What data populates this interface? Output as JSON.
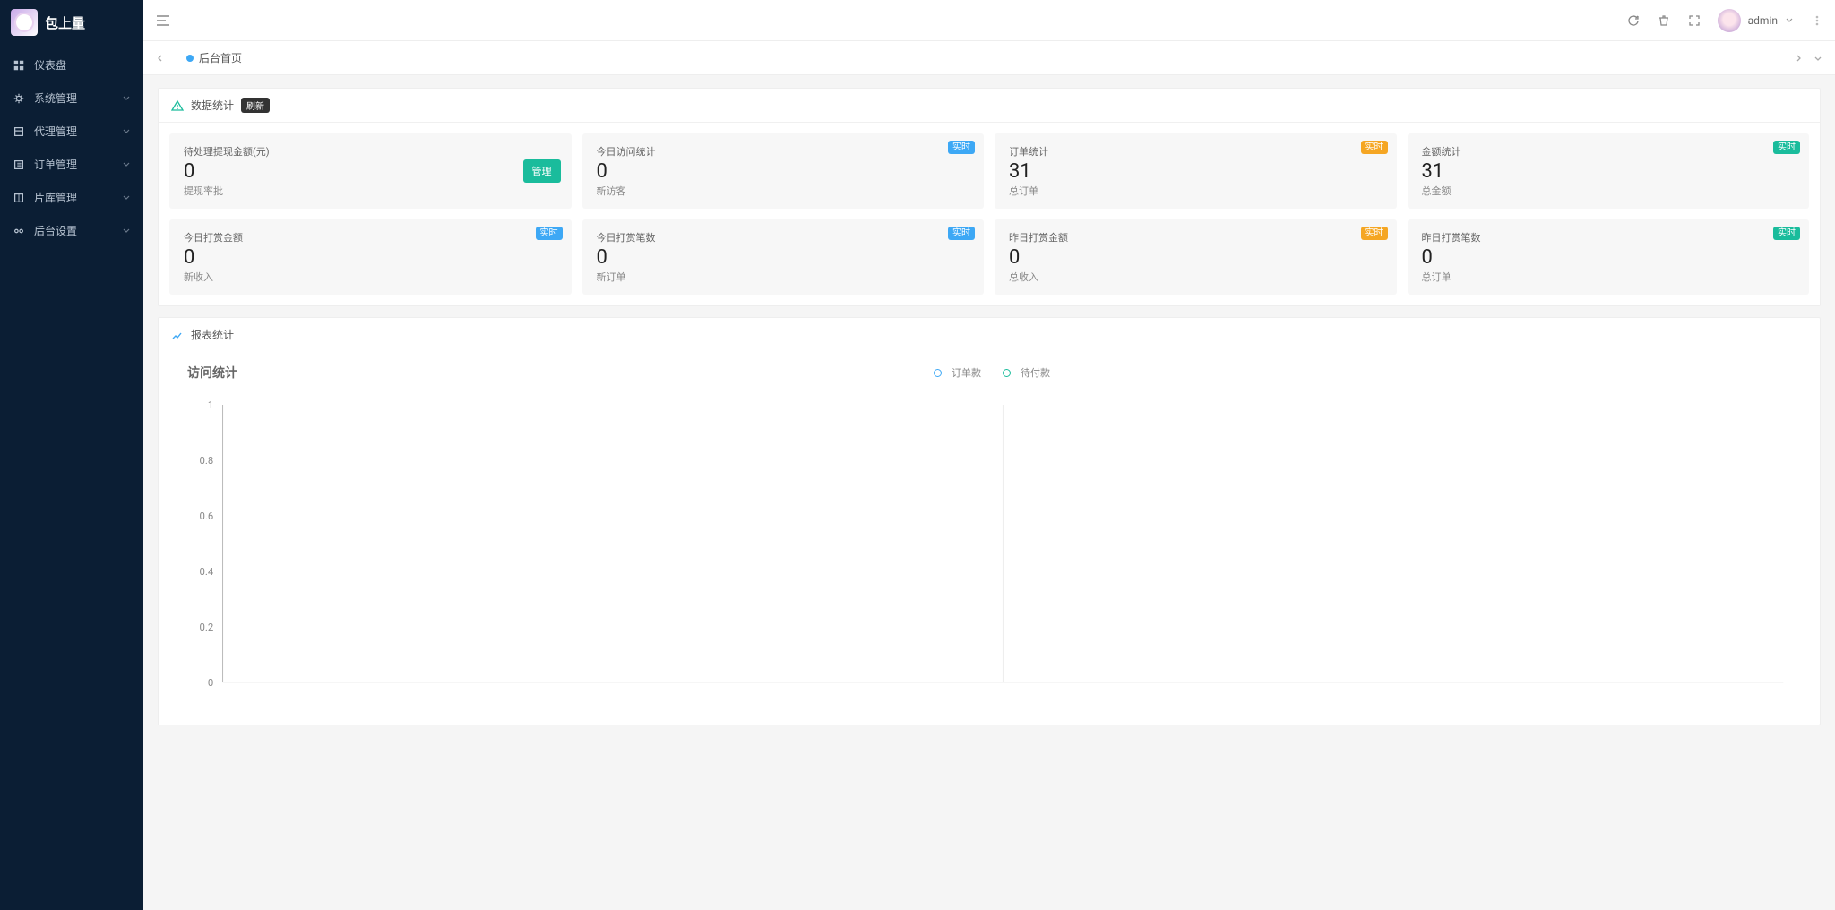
{
  "app_name": "包上量",
  "user": {
    "name": "admin"
  },
  "sidebar": {
    "items": [
      {
        "label": "仪表盘",
        "icon": "dashboard",
        "expandable": false
      },
      {
        "label": "系统管理",
        "icon": "gear",
        "expandable": true
      },
      {
        "label": "代理管理",
        "icon": "box",
        "expandable": true
      },
      {
        "label": "订单管理",
        "icon": "list",
        "expandable": true
      },
      {
        "label": "片库管理",
        "icon": "film",
        "expandable": true
      },
      {
        "label": "后台设置",
        "icon": "cog",
        "expandable": true
      }
    ]
  },
  "tab": {
    "label": "后台首页"
  },
  "panels": {
    "stats": {
      "title": "数据统计",
      "refresh": "刷新"
    },
    "report": {
      "title": "报表统计"
    }
  },
  "stats": [
    {
      "title": "待处理提现金额(元)",
      "value": "0",
      "sub": "提现率批",
      "badge": null,
      "manage": "管理"
    },
    {
      "title": "今日访问统计",
      "value": "0",
      "sub": "新访客",
      "badge": "实时",
      "badgeColor": "blue"
    },
    {
      "title": "订单统计",
      "value": "31",
      "sub": "总订单",
      "badge": "实时",
      "badgeColor": "orange"
    },
    {
      "title": "金额统计",
      "value": "31",
      "sub": "总金额",
      "badge": "实时",
      "badgeColor": "green"
    },
    {
      "title": "今日打赏金额",
      "value": "0",
      "sub": "新收入",
      "badge": "实时",
      "badgeColor": "blue"
    },
    {
      "title": "今日打赏笔数",
      "value": "0",
      "sub": "新订单",
      "badge": "实时",
      "badgeColor": "blue"
    },
    {
      "title": "昨日打赏金额",
      "value": "0",
      "sub": "总收入",
      "badge": "实时",
      "badgeColor": "orange"
    },
    {
      "title": "昨日打赏笔数",
      "value": "0",
      "sub": "总订单",
      "badge": "实时",
      "badgeColor": "green"
    }
  ],
  "chart_data": {
    "type": "line",
    "title": "访问统计",
    "legend": [
      "订单款",
      "待付款"
    ],
    "ylabel": "",
    "xlabel": "",
    "ylim": [
      0,
      1
    ],
    "yticks": [
      0,
      0.2,
      0.4,
      0.6,
      0.8,
      1
    ],
    "x": [],
    "series": [
      {
        "name": "订单款",
        "values": []
      },
      {
        "name": "待付款",
        "values": []
      }
    ]
  }
}
